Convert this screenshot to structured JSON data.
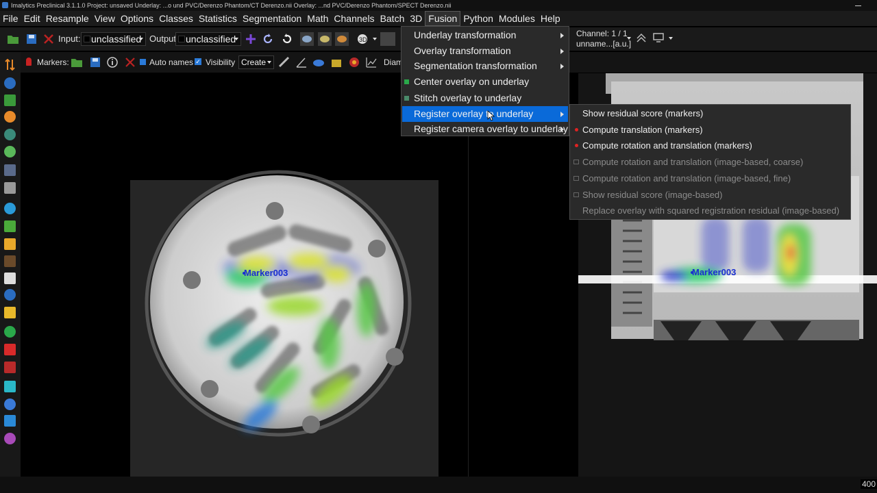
{
  "window": {
    "title": "Imalytics Preclinical 3.1.1.0 Project: unsaved  Underlay: ...o und PVC/Derenzo Phantom/CT Derenzo.nii   Overlay: ...nd PVC/Derenzo Phantom/SPECT Derenzo.nii"
  },
  "menubar": {
    "items": [
      "File",
      "Edit",
      "Resample",
      "View",
      "Options",
      "Classes",
      "Statistics",
      "Segmentation",
      "Math",
      "Channels",
      "Batch",
      "3D",
      "Fusion",
      "Python",
      "Modules",
      "Help"
    ],
    "active": "Fusion"
  },
  "toolbar": {
    "input_label": "Input:",
    "input_value": "unclassified",
    "output_label": "Output:",
    "output_value": "unclassified"
  },
  "markers_bar": {
    "markers_label": "Markers:",
    "auto_names_label": "Auto names",
    "auto_names_checked": true,
    "visibility_label": "Visibility",
    "visibility_checked": true,
    "create_value": "Create",
    "diam_label": "Diam"
  },
  "channel": {
    "line1": "Channel: 1 / 1",
    "line2": "unname...[a.u.]"
  },
  "fusion_menu": {
    "items": [
      {
        "label": "Underlay transformation",
        "submenu": true,
        "icon": "",
        "highlighted": false
      },
      {
        "label": "Overlay transformation",
        "submenu": true,
        "icon": "",
        "highlighted": false
      },
      {
        "label": "Segmentation transformation",
        "submenu": true,
        "icon": "",
        "highlighted": false
      },
      {
        "label": "Center overlay on underlay",
        "submenu": false,
        "icon": "center-icon",
        "highlighted": false
      },
      {
        "label": "Stitch overlay to underlay",
        "submenu": false,
        "icon": "stitch-icon",
        "highlighted": false
      },
      {
        "label": "Register overlay to underlay",
        "submenu": true,
        "icon": "",
        "highlighted": true
      },
      {
        "label": "Register camera overlay to underlay",
        "submenu": true,
        "icon": "",
        "highlighted": false
      }
    ]
  },
  "register_submenu": {
    "items": [
      {
        "label": "Show residual score (markers)",
        "enabled": true,
        "icon": "none"
      },
      {
        "label": "Compute translation (markers)",
        "enabled": true,
        "icon": "marker-dot-icon"
      },
      {
        "label": "Compute rotation and translation (markers)",
        "enabled": true,
        "icon": "marker-dot-icon"
      },
      {
        "label": "Compute rotation and translation (image-based, coarse)",
        "enabled": false,
        "icon": "image-icon"
      },
      {
        "label": "Compute rotation and translation (image-based, fine)",
        "enabled": false,
        "icon": "image-icon"
      },
      {
        "label": "Show residual score (image-based)",
        "enabled": false,
        "icon": "image-icon"
      },
      {
        "label": "Replace overlay with squared registration residual (image-based)",
        "enabled": false,
        "icon": "none"
      }
    ]
  },
  "views": {
    "left_marker": "Marker003",
    "right_marker": "Marker003"
  },
  "status": {
    "zoom": "400"
  },
  "colors": {
    "highlight": "#0a6ad9",
    "marker_text": "#1a2fd0",
    "marker_dot": "#e02222"
  }
}
